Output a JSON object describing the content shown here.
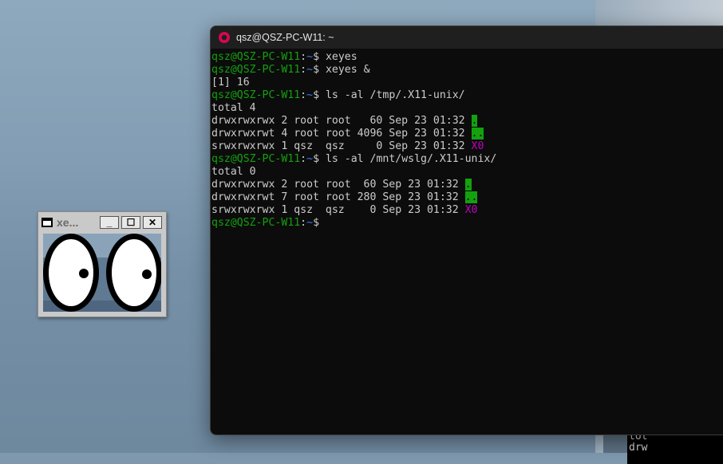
{
  "terminal": {
    "title": "qsz@QSZ-PC-W11: ~",
    "lines": [
      [
        {
          "t": "qsz@QSZ-PC-W11",
          "c": "g"
        },
        {
          "t": ":",
          "c": ""
        },
        {
          "t": "~",
          "c": "b"
        },
        {
          "t": "$ xeyes",
          "c": ""
        }
      ],
      [
        {
          "t": "qsz@QSZ-PC-W11",
          "c": "g"
        },
        {
          "t": ":",
          "c": ""
        },
        {
          "t": "~",
          "c": "b"
        },
        {
          "t": "$ xeyes &",
          "c": ""
        }
      ],
      [
        {
          "t": "[1] 16",
          "c": ""
        }
      ],
      [
        {
          "t": "qsz@QSZ-PC-W11",
          "c": "g"
        },
        {
          "t": ":",
          "c": ""
        },
        {
          "t": "~",
          "c": "b"
        },
        {
          "t": "$ ls -al /tmp/.X11-unix/",
          "c": ""
        }
      ],
      [
        {
          "t": "total 4",
          "c": ""
        }
      ],
      [
        {
          "t": "drwxrwxrwx 2 root root   60 Sep 23 01:32 ",
          "c": ""
        },
        {
          "t": ".",
          "c": "hl"
        }
      ],
      [
        {
          "t": "drwxrwxrwt 4 root root 4096 Sep 23 01:32 ",
          "c": ""
        },
        {
          "t": "..",
          "c": "hl"
        }
      ],
      [
        {
          "t": "srwxrwxrwx 1 qsz  qsz     0 Sep 23 01:32 ",
          "c": ""
        },
        {
          "t": "X0",
          "c": "m"
        }
      ],
      [
        {
          "t": "qsz@QSZ-PC-W11",
          "c": "g"
        },
        {
          "t": ":",
          "c": ""
        },
        {
          "t": "~",
          "c": "b"
        },
        {
          "t": "$ ls -al /mnt/wslg/.X11-unix/",
          "c": ""
        }
      ],
      [
        {
          "t": "total 0",
          "c": ""
        }
      ],
      [
        {
          "t": "drwxrwxrwx 2 root root  60 Sep 23 01:32 ",
          "c": ""
        },
        {
          "t": ".",
          "c": "hl"
        }
      ],
      [
        {
          "t": "drwxrwxrwt 7 root root 280 Sep 23 01:32 ",
          "c": ""
        },
        {
          "t": "..",
          "c": "hl"
        }
      ],
      [
        {
          "t": "srwxrwxrwx 1 qsz  qsz    0 Sep 23 01:32 ",
          "c": ""
        },
        {
          "t": "X0",
          "c": "m"
        }
      ],
      [
        {
          "t": "qsz@QSZ-PC-W11",
          "c": "g"
        },
        {
          "t": ":",
          "c": ""
        },
        {
          "t": "~",
          "c": "b"
        },
        {
          "t": "$ ",
          "c": ""
        }
      ]
    ]
  },
  "xeyes": {
    "title": "xe...",
    "minimize_label": "_",
    "maximize_label": "☐",
    "close_label": "✕"
  },
  "behind_text": [
    "tot",
    "drw"
  ],
  "colors": {
    "prompt_green": "#13a10e",
    "path_blue": "#3b78ff",
    "socket_magenta": "#c100c3",
    "terminal_bg": "#0c0c0c"
  }
}
